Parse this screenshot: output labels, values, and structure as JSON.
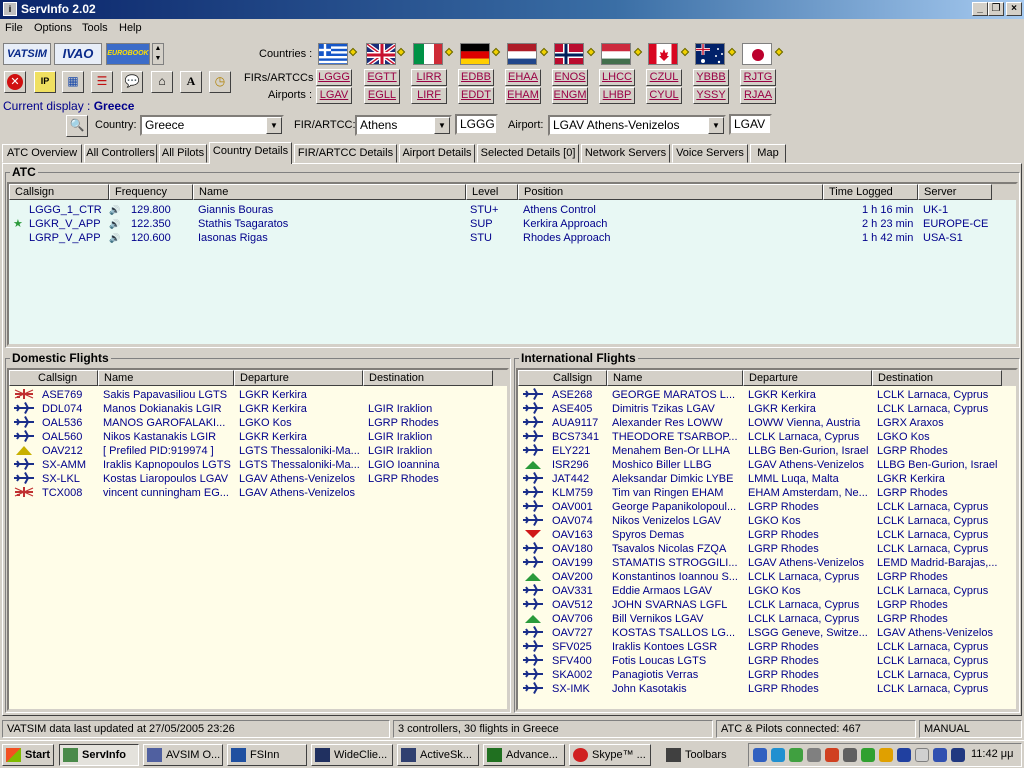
{
  "window": {
    "title": "ServInfo 2.02",
    "icon": "servinfo-app-icon"
  },
  "menu": [
    "File",
    "Options",
    "Tools",
    "Help"
  ],
  "logos": [
    "VATSIM",
    "IVAO",
    "EUROBOOK"
  ],
  "toolbar": {
    "countries_label": "Countries :",
    "firs_label": "FIRs/ARTCCs :",
    "airports_label": "Airports :",
    "flags": [
      "greece",
      "united-kingdom",
      "italy",
      "germany",
      "netherlands",
      "norway",
      "hungary",
      "canada",
      "australia",
      "japan"
    ],
    "firs": [
      "LGGG",
      "EGTT",
      "LIRR",
      "EDBB",
      "EHAA",
      "ENOS",
      "LHCC",
      "CZUL",
      "YBBB",
      "RJTG"
    ],
    "airports": [
      "LGAV",
      "EGLL",
      "LIRF",
      "EDDT",
      "EHAM",
      "ENGM",
      "LHBP",
      "CYUL",
      "YSSY",
      "RJAA"
    ],
    "tool_icons": [
      "close-red-icon",
      "ip-icon",
      "grid-icon",
      "list-icon",
      "chat-icon",
      "network-icon",
      "font-icon",
      "clock-icon"
    ]
  },
  "current_display": {
    "label": "Current display :",
    "value": "Greece"
  },
  "filters": {
    "country_label": "Country:",
    "country_value": "Greece",
    "fir_label": "FIR/ARTCC:",
    "fir_value": "Athens",
    "fir_code": "LGGG",
    "airport_label": "Airport:",
    "airport_value": "LGAV Athens-Venizelos",
    "airport_code": "LGAV"
  },
  "tabs": [
    "ATC Overview",
    "All Controllers",
    "All Pilots",
    "Country Details",
    "FIR/ARTCC Details",
    "Airport Details",
    "Selected Details [0]",
    "Network Servers",
    "Voice Servers",
    "Map"
  ],
  "active_tab": "Country Details",
  "atc": {
    "title": "ATC",
    "columns": [
      "Callsign",
      "Frequency",
      "Name",
      "Level",
      "Position",
      "Time Logged",
      "Server"
    ],
    "rows": [
      {
        "callsign": "LGGG_1_CTR",
        "frequency": "129.800",
        "name": "Giannis Bouras",
        "level": "STU+",
        "position": "Athens Control",
        "time": "1 h 16 min",
        "server": "UK-1",
        "star": false
      },
      {
        "callsign": "LGKR_V_APP",
        "frequency": "122.350",
        "name": "Stathis Tsagaratos",
        "level": "SUP",
        "position": "Kerkira Approach",
        "time": "2 h 23 min",
        "server": "EUROPE-CE",
        "star": true
      },
      {
        "callsign": "LGRP_V_APP",
        "frequency": "120.600",
        "name": "Iasonas Rigas",
        "level": "STU",
        "position": "Rhodes Approach",
        "time": "1 h 42 min",
        "server": "USA-S1",
        "star": false
      }
    ]
  },
  "domestic": {
    "title": "Domestic Flights",
    "columns": [
      "Callsign",
      "Name",
      "Departure",
      "Destination"
    ],
    "rows": [
      {
        "icon": "prefiled",
        "callsign": "ASE769",
        "name": "Sakis Papavasiliou LGTS",
        "departure": "LGKR Kerkira",
        "destination": ""
      },
      {
        "icon": "airborne",
        "callsign": "DDL074",
        "name": "Manos Dokianakis LGIR",
        "departure": "LGKR Kerkira",
        "destination": "LGIR Iraklion"
      },
      {
        "icon": "airborne",
        "callsign": "OAL536",
        "name": "MANOS GAROFALAKI...",
        "departure": "LGKO Kos",
        "destination": "LGRP Rhodes"
      },
      {
        "icon": "airborne",
        "callsign": "OAL560",
        "name": "Nikos Kastanakis LGIR",
        "departure": "LGKR Kerkira",
        "destination": "LGIR Iraklion"
      },
      {
        "icon": "ground",
        "callsign": "OAV212",
        "name": "[ Prefiled PID:919974 ]",
        "departure": "LGTS Thessaloniki-Ma...",
        "destination": "LGIR Iraklion"
      },
      {
        "icon": "airborne",
        "callsign": "SX-AMM",
        "name": "Iraklis Kapnopoulos LGTS",
        "departure": "LGTS Thessaloniki-Ma...",
        "destination": "LGIO Ioannina"
      },
      {
        "icon": "airborne",
        "callsign": "SX-LKL",
        "name": "Kostas Liaropoulos LGAV",
        "departure": "LGAV Athens-Venizelos",
        "destination": "LGRP Rhodes"
      },
      {
        "icon": "prefiled",
        "callsign": "TCX008",
        "name": "vincent cunningham EG...",
        "departure": "LGAV Athens-Venizelos",
        "destination": ""
      }
    ]
  },
  "international": {
    "title": "International Flights",
    "columns": [
      "Callsign",
      "Name",
      "Departure",
      "Destination"
    ],
    "rows": [
      {
        "icon": "airborne",
        "callsign": "ASE268",
        "name": "GEORGE MARATOS L...",
        "departure": "LGKR Kerkira",
        "destination": "LCLK Larnaca, Cyprus"
      },
      {
        "icon": "airborne",
        "callsign": "ASE405",
        "name": "Dimitris Tzikas LGAV",
        "departure": "LGKR Kerkira",
        "destination": "LCLK Larnaca, Cyprus"
      },
      {
        "icon": "airborne",
        "callsign": "AUA9117",
        "name": "Alexander Res LOWW",
        "departure": "LOWW Vienna, Austria",
        "destination": "LGRX Araxos"
      },
      {
        "icon": "airborne",
        "callsign": "BCS7341",
        "name": "THEODORE TSARBOP...",
        "departure": "LCLK Larnaca, Cyprus",
        "destination": "LGKO Kos"
      },
      {
        "icon": "airborne",
        "callsign": "ELY221",
        "name": "Menahem Ben-Or LLHA",
        "departure": "LLBG Ben-Gurion, Israel",
        "destination": "LGRP Rhodes"
      },
      {
        "icon": "climbing",
        "callsign": "ISR296",
        "name": "Moshico Biller LLBG",
        "departure": "LGAV Athens-Venizelos",
        "destination": "LLBG Ben-Gurion, Israel"
      },
      {
        "icon": "airborne",
        "callsign": "JAT442",
        "name": "Aleksandar Dimkic LYBE",
        "departure": "LMML Luqa, Malta",
        "destination": "LGKR Kerkira"
      },
      {
        "icon": "airborne",
        "callsign": "KLM759",
        "name": "Tim van Ringen EHAM",
        "departure": "EHAM Amsterdam, Ne...",
        "destination": "LGRP Rhodes"
      },
      {
        "icon": "airborne",
        "callsign": "OAV001",
        "name": "George Papanikolopoul...",
        "departure": "LGRP Rhodes",
        "destination": "LCLK Larnaca, Cyprus"
      },
      {
        "icon": "airborne",
        "callsign": "OAV074",
        "name": "Nikos Venizelos LGAV",
        "departure": "LGKO Kos",
        "destination": "LCLK Larnaca, Cyprus"
      },
      {
        "icon": "descending",
        "callsign": "OAV163",
        "name": "Spyros Demas",
        "departure": "LGRP Rhodes",
        "destination": "LCLK Larnaca, Cyprus"
      },
      {
        "icon": "airborne",
        "callsign": "OAV180",
        "name": "Tsavalos Nicolas FZQA",
        "departure": "LGRP Rhodes",
        "destination": "LCLK Larnaca, Cyprus"
      },
      {
        "icon": "airborne",
        "callsign": "OAV199",
        "name": "STAMATIS STROGGILI...",
        "departure": "LGAV Athens-Venizelos",
        "destination": "LEMD Madrid-Barajas,..."
      },
      {
        "icon": "climbing",
        "callsign": "OAV200",
        "name": "Konstantinos Ioannou S...",
        "departure": "LCLK Larnaca, Cyprus",
        "destination": "LGRP Rhodes"
      },
      {
        "icon": "airborne",
        "callsign": "OAV331",
        "name": "Eddie Armaos LGAV",
        "departure": "LGKO Kos",
        "destination": "LCLK Larnaca, Cyprus"
      },
      {
        "icon": "airborne",
        "callsign": "OAV512",
        "name": "JOHN SVARNAS LGFL",
        "departure": "LCLK Larnaca, Cyprus",
        "destination": "LGRP Rhodes"
      },
      {
        "icon": "climbing",
        "callsign": "OAV706",
        "name": "Bill Vernikos LGAV",
        "departure": "LCLK Larnaca, Cyprus",
        "destination": "LGRP Rhodes"
      },
      {
        "icon": "airborne",
        "callsign": "OAV727",
        "name": "KOSTAS TSALLOS LG...",
        "departure": "LSGG Geneve, Switze...",
        "destination": "LGAV Athens-Venizelos"
      },
      {
        "icon": "airborne",
        "callsign": "SFV025",
        "name": "Iraklis Kontoes LGSR",
        "departure": "LGRP Rhodes",
        "destination": "LCLK Larnaca, Cyprus"
      },
      {
        "icon": "airborne",
        "callsign": "SFV400",
        "name": "Fotis Loucas  LGTS",
        "departure": "LGRP Rhodes",
        "destination": "LCLK Larnaca, Cyprus"
      },
      {
        "icon": "airborne",
        "callsign": "SKA002",
        "name": "Panagiotis Verras",
        "departure": "LGRP Rhodes",
        "destination": "LCLK Larnaca, Cyprus"
      },
      {
        "icon": "airborne",
        "callsign": "SX-IMK",
        "name": "John Kasotakis",
        "departure": "LGRP Rhodes",
        "destination": "LCLK Larnaca, Cyprus"
      }
    ]
  },
  "status": {
    "updated": "VATSIM data last updated at 27/05/2005 23:26",
    "counts": "3 controllers, 30 flights in Greece",
    "connected": "ATC & Pilots connected: 467",
    "mode": "MANUAL"
  },
  "taskbar": {
    "start": "Start",
    "tasks": [
      "ServInfo",
      "AVSIM O...",
      "FSInn",
      "WideClie...",
      "ActiveSk...",
      "Advance...",
      "Skype™ ...",
      "Toolbars"
    ],
    "active_task": "ServInfo",
    "clock": "11:42 μμ"
  },
  "colors": {
    "titlebar": "#0a246a",
    "row_text": "#00008b",
    "code_link": "#9a0044",
    "atc_bg": "#e8f8f4",
    "flights_bg": "#fffde8"
  }
}
